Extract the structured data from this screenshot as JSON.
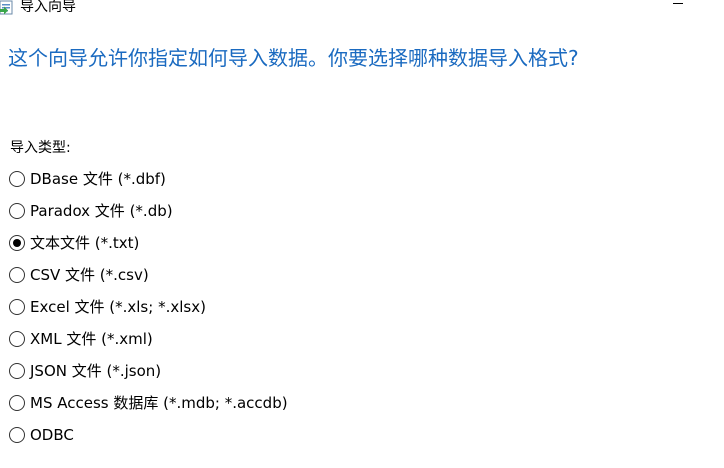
{
  "window": {
    "title": "导入向导",
    "icon": "import-wizard-icon"
  },
  "heading": "这个向导允许你指定如何导入数据。你要选择哪种数据导入格式?",
  "import_type": {
    "label": "导入类型:",
    "selected_index": 2,
    "options": [
      {
        "label": "DBase 文件 (*.dbf)",
        "checked": false
      },
      {
        "label": "Paradox 文件 (*.db)",
        "checked": false
      },
      {
        "label": "文本文件 (*.txt)",
        "checked": true
      },
      {
        "label": "CSV 文件 (*.csv)",
        "checked": false
      },
      {
        "label": "Excel 文件 (*.xls; *.xlsx)",
        "checked": false
      },
      {
        "label": "XML 文件 (*.xml)",
        "checked": false
      },
      {
        "label": "JSON 文件 (*.json)",
        "checked": false
      },
      {
        "label": "MS Access 数据库 (*.mdb; *.accdb)",
        "checked": false
      },
      {
        "label": "ODBC",
        "checked": false
      }
    ]
  },
  "colors": {
    "heading": "#1a6ac0",
    "background": "#ffffff",
    "text": "#000000"
  }
}
